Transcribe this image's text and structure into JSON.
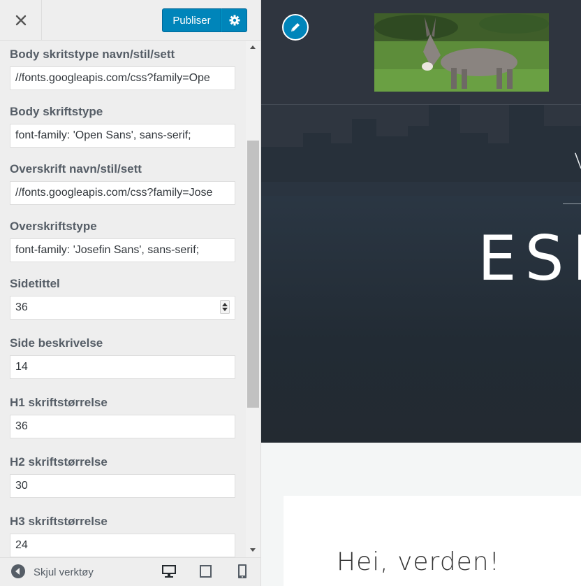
{
  "header": {
    "close_icon": "close-icon",
    "publish_label": "Publiser",
    "publish_settings_icon": "gear-icon",
    "accent_color": "#0085ba"
  },
  "fields": [
    {
      "label": "Body skritstype navn/stil/sett",
      "value": "//fonts.googleapis.com/css?family=Ope"
    },
    {
      "label": "Body skriftstype",
      "value": "font-family: 'Open Sans', sans-serif;"
    },
    {
      "label": "Overskrift navn/stil/sett",
      "value": "//fonts.googleapis.com/css?family=Jose"
    },
    {
      "label": "Overskriftstype",
      "value": "font-family: 'Josefin Sans', sans-serif;"
    },
    {
      "label": "Sidetittel",
      "value": "36"
    },
    {
      "label": "Side beskrivelse",
      "value": "14"
    },
    {
      "label": "H1 skriftstørrelse",
      "value": "36"
    },
    {
      "label": "H2 skriftstørrelse",
      "value": "30"
    },
    {
      "label": "H3 skriftstørrelse",
      "value": "24"
    }
  ],
  "footer": {
    "collapse_label": "Skjul verktøy",
    "devices": [
      "desktop-icon",
      "tablet-icon",
      "mobile-icon"
    ]
  },
  "preview": {
    "hero_subtitle": "V",
    "hero_title": "ESE",
    "post_title": "Hei, verden!",
    "edit_icon": "pencil-icon",
    "logo_alt": "donkey-logo"
  }
}
